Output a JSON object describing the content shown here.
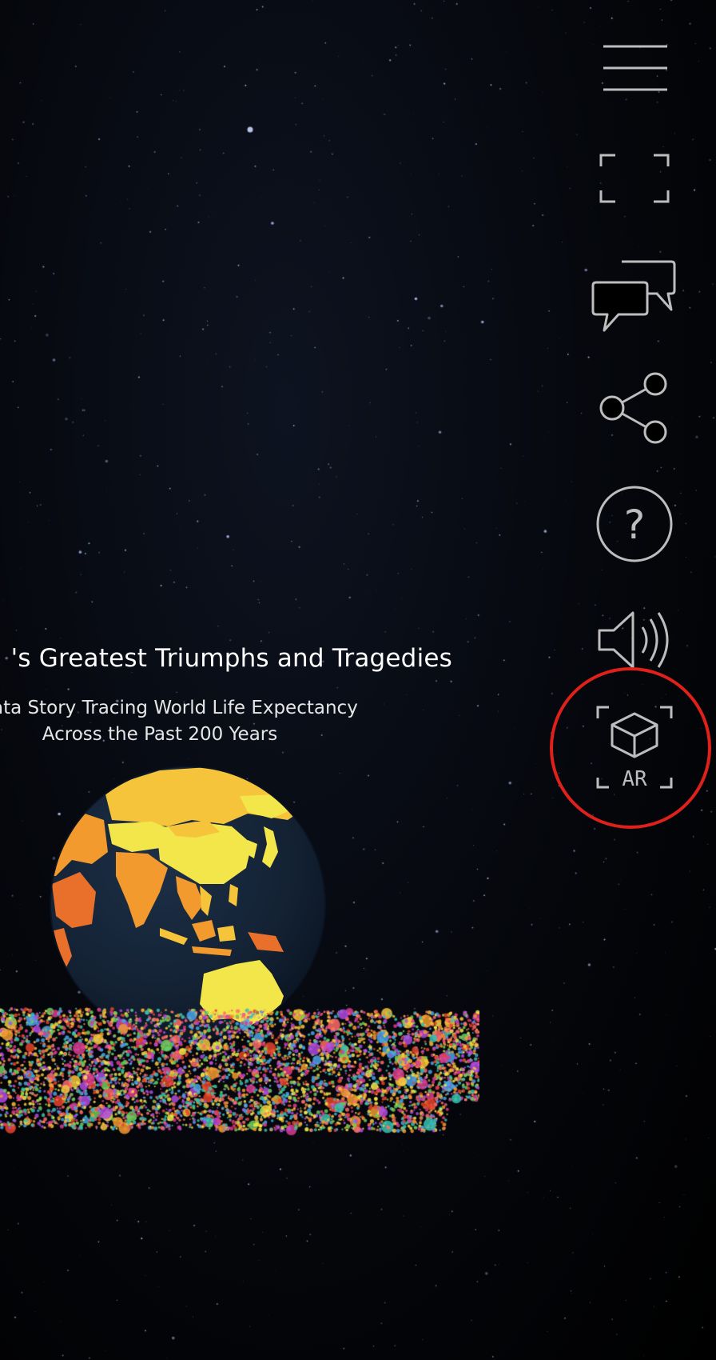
{
  "story": {
    "title": "'s Greatest Triumphs and Tragedies",
    "subtitle_line1": "ata Story Tracing World Life Expectancy",
    "subtitle_line2": "Across the Past 200 Years"
  },
  "toolbar": {
    "items": [
      {
        "icon": "menu-icon"
      },
      {
        "icon": "fullscreen-icon"
      },
      {
        "icon": "chat-icon"
      },
      {
        "icon": "share-icon"
      },
      {
        "icon": "help-icon",
        "glyph": "?"
      },
      {
        "icon": "sound-icon"
      },
      {
        "icon": "ar-icon",
        "label": "AR"
      }
    ]
  },
  "colors": {
    "background": "#000000",
    "icon_stroke": "#bdbdbd",
    "highlight": "#e0201b",
    "globe_ocean": "#152337",
    "land_yellow": "#f2e64a",
    "land_gold": "#f5c43b",
    "land_orange": "#f29a2e",
    "land_dark_orange": "#e8702a"
  },
  "annotation": {
    "highlighted_control": "ar-button"
  }
}
